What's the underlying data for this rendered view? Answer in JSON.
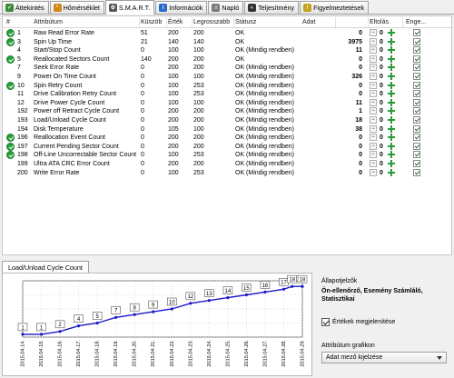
{
  "tabs": [
    {
      "label": "Áttekintés",
      "icon": "overview-icon",
      "color": "#3a8a3a"
    },
    {
      "label": "Hőmérséklet",
      "icon": "thermometer-icon",
      "color": "#d08a1a"
    },
    {
      "label": "S.M.A.R.T.",
      "icon": "smart-icon",
      "color": "#555555",
      "active": true
    },
    {
      "label": "Információk",
      "icon": "info-icon",
      "color": "#2a6ac8"
    },
    {
      "label": "Napló",
      "icon": "log-icon",
      "color": "#7a7a7a"
    },
    {
      "label": "Teljesítmény",
      "icon": "performance-icon",
      "color": "#333333"
    },
    {
      "label": "Figyelmeztetések",
      "icon": "alerts-icon",
      "color": "#c8a020"
    }
  ],
  "table": {
    "headers": {
      "num": "#",
      "attr": "Attribútum",
      "threshold": "Küszöb",
      "value": "Érték",
      "worst": "Legrosszabb",
      "status": "Státusz",
      "data": "Adat",
      "offset": "Eltolás",
      "enable": "Enge..."
    },
    "rows": [
      {
        "ok": true,
        "num": "1",
        "attr": "Raw Read Error Rate",
        "threshold": "51",
        "value": "200",
        "worst": "200",
        "status": "OK",
        "data": "0"
      },
      {
        "ok": true,
        "num": "3",
        "attr": "Spin Up Time",
        "threshold": "21",
        "value": "140",
        "worst": "140",
        "status": "OK",
        "data": "3975"
      },
      {
        "ok": false,
        "num": "4",
        "attr": "Start/Stop Count",
        "threshold": "0",
        "value": "100",
        "worst": "100",
        "status": "OK (Mindig rendben)",
        "data": "11"
      },
      {
        "ok": true,
        "num": "5",
        "attr": "Reallocated Sectors Count",
        "threshold": "140",
        "value": "200",
        "worst": "200",
        "status": "OK",
        "data": "0"
      },
      {
        "ok": false,
        "num": "7",
        "attr": "Seek Error Rate",
        "threshold": "0",
        "value": "200",
        "worst": "200",
        "status": "OK (Mindig rendben)",
        "data": "0"
      },
      {
        "ok": false,
        "num": "9",
        "attr": "Power On Time Count",
        "threshold": "0",
        "value": "100",
        "worst": "100",
        "status": "OK (Mindig rendben)",
        "data": "326"
      },
      {
        "ok": true,
        "num": "10",
        "attr": "Spin Retry Count",
        "threshold": "0",
        "value": "100",
        "worst": "253",
        "status": "OK (Mindig rendben)",
        "data": "0"
      },
      {
        "ok": false,
        "num": "11",
        "attr": "Drive Calibration Retry Count",
        "threshold": "0",
        "value": "100",
        "worst": "253",
        "status": "OK (Mindig rendben)",
        "data": "0"
      },
      {
        "ok": false,
        "num": "12",
        "attr": "Drive Power Cycle Count",
        "threshold": "0",
        "value": "100",
        "worst": "100",
        "status": "OK (Mindig rendben)",
        "data": "11"
      },
      {
        "ok": false,
        "num": "192",
        "attr": "Power off Retract Cycle Count",
        "threshold": "0",
        "value": "200",
        "worst": "200",
        "status": "OK (Mindig rendben)",
        "data": "1"
      },
      {
        "ok": false,
        "num": "193",
        "attr": "Load/Unload Cycle Count",
        "threshold": "0",
        "value": "200",
        "worst": "200",
        "status": "OK (Mindig rendben)",
        "data": "18"
      },
      {
        "ok": false,
        "num": "194",
        "attr": "Disk Temperature",
        "threshold": "0",
        "value": "105",
        "worst": "100",
        "status": "OK (Mindig rendben)",
        "data": "38"
      },
      {
        "ok": true,
        "num": "196",
        "attr": "Reallocation Event Count",
        "threshold": "0",
        "value": "200",
        "worst": "200",
        "status": "OK (Mindig rendben)",
        "data": "0"
      },
      {
        "ok": true,
        "num": "197",
        "attr": "Current Pending Sector Count",
        "threshold": "0",
        "value": "200",
        "worst": "200",
        "status": "OK (Mindig rendben)",
        "data": "0"
      },
      {
        "ok": true,
        "num": "198",
        "attr": "Off-Line Uncorrectable Sector Count",
        "threshold": "0",
        "value": "100",
        "worst": "253",
        "status": "OK (Mindig rendben)",
        "data": "0"
      },
      {
        "ok": false,
        "num": "199",
        "attr": "Ultra ATA CRC Error Count",
        "threshold": "0",
        "value": "200",
        "worst": "200",
        "status": "OK (Mindig rendben)",
        "data": "0"
      },
      {
        "ok": false,
        "num": "200",
        "attr": "Write Error Rate",
        "threshold": "0",
        "value": "100",
        "worst": "253",
        "status": "OK (Mindig rendben)",
        "data": "0"
      }
    ],
    "offset_value": "0"
  },
  "bottom_tab": {
    "label": "Load/Unload Cycle Count"
  },
  "right_panel": {
    "title": "Állapotjelzők",
    "value": "Ön-ellenőrző, Esemény Számláló, Statisztikai",
    "checkbox_label": "Értékek megjelenítése",
    "select_label": "Attribútum grafikon",
    "select_value": "Adat mező kijelzése"
  },
  "chart_data": {
    "type": "line",
    "categories": [
      "2015.04.14.",
      "2015.04.15.",
      "2015.04.16.",
      "2015.04.17.",
      "2015.04.18.",
      "2015.04.19.",
      "2015.04.20.",
      "2015.04.21.",
      "2015.04.22.",
      "2015.04.23.",
      "2015.04.24.",
      "2015.04.25.",
      "2015.04.26.",
      "2015.04.27.",
      "2015.04.28.",
      "2015.04.29."
    ],
    "points": [
      {
        "x": "2015.04.14.",
        "y": 1
      },
      {
        "x": "2015.04.15.",
        "y": 1
      },
      {
        "x": "2015.04.16.",
        "y": 2
      },
      {
        "x": "2015.04.17.",
        "y": 4
      },
      {
        "x": "2015.04.18.",
        "y": 5
      },
      {
        "x": "2015.04.19.",
        "y": 7
      },
      {
        "x": "2015.04.20.",
        "y": 8
      },
      {
        "x": "2015.04.21.",
        "y": 9
      },
      {
        "x": "2015.04.22.",
        "y": 10
      },
      {
        "x": "2015.04.23.",
        "y": 12
      },
      {
        "x": "2015.04.24.",
        "y": 13
      },
      {
        "x": "2015.04.25.",
        "y": 14
      },
      {
        "x": "2015.04.26.",
        "y": 15
      },
      {
        "x": "2015.04.27.",
        "y": 16
      },
      {
        "x": "2015.04.28.",
        "y": 17
      },
      {
        "x": "2015.04.28.",
        "y": 18
      },
      {
        "x": "2015.04.29.",
        "y": 18
      }
    ],
    "ylim": [
      0,
      20
    ],
    "grid": true,
    "line_color": "#1a1ac8",
    "values_shown": true
  }
}
